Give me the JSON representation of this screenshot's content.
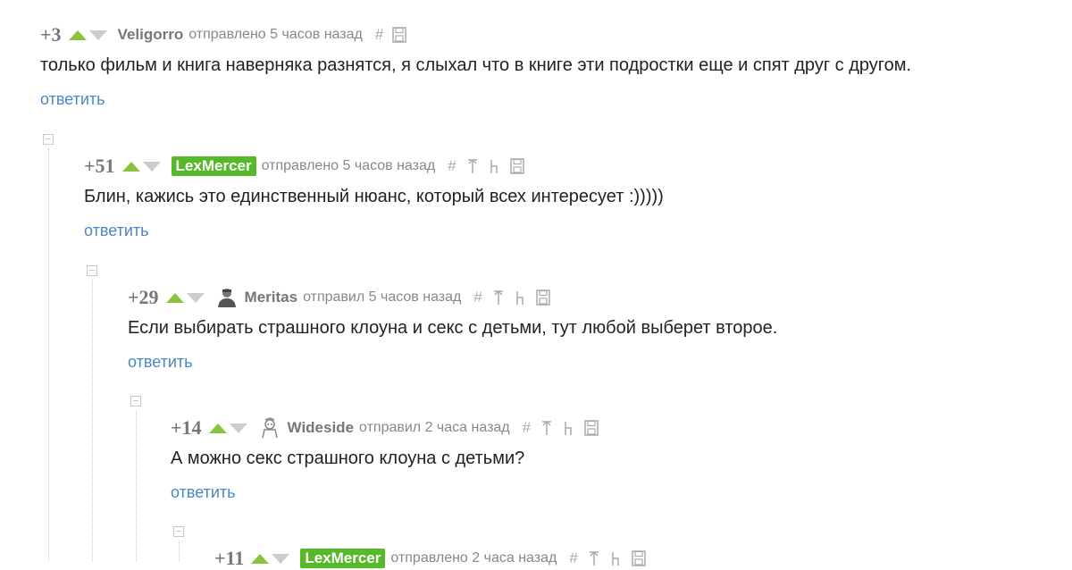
{
  "comments": [
    {
      "rating": "+3",
      "user": "Veligorro",
      "meta": "отправлено 5 часов назад",
      "text": "только фильм и книга наверняка разнятся, я слыхал что в книге эти подростки еще и спят друг с другом.",
      "reply_label": "ответить",
      "hash_label": "#"
    },
    {
      "rating": "+51",
      "user": "LexMercer",
      "meta": "отправлено 5 часов назад",
      "text": "Блин, кажись это единственный нюанс, который всех интересует :)))))",
      "reply_label": "ответить",
      "hash_label": "#"
    },
    {
      "rating": "+29",
      "user": "Meritas",
      "meta": "отправил 5 часов назад",
      "text": "Если выбирать страшного клоуна и секс с детьми, тут любой выберет второе.",
      "reply_label": "ответить",
      "hash_label": "#"
    },
    {
      "rating": "+14",
      "user": "Wideside",
      "meta": "отправил 2 часа назад",
      "text": "А можно секс страшного клоуна с детьми?",
      "reply_label": "ответить",
      "hash_label": "#"
    },
    {
      "rating": "+11",
      "user": "LexMercer",
      "meta": "отправлено 2 часа назад",
      "hash_label": "#"
    }
  ],
  "colors": {
    "upvote": "#8ac43f",
    "downvote": "#cccccc",
    "user_badge": "#55b92a",
    "reply_link": "#4a88c2"
  },
  "icons": [
    "vote-up-icon",
    "vote-down-icon",
    "link-hash-icon",
    "parent-arrow-icon",
    "branch-icon",
    "save-icon"
  ]
}
